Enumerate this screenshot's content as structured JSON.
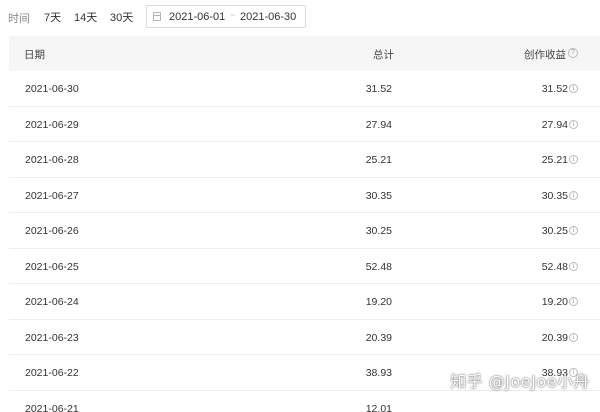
{
  "filter": {
    "label": "时间",
    "ranges": [
      "7天",
      "14天",
      "30天"
    ],
    "date_start": "2021-06-01",
    "date_separator": "~",
    "date_end": "2021-06-30"
  },
  "table": {
    "headers": {
      "date": "日期",
      "total": "总计",
      "income": "创作收益"
    },
    "rows": [
      {
        "date": "2021-06-30",
        "total": "31.52",
        "income": "31.52"
      },
      {
        "date": "2021-06-29",
        "total": "27.94",
        "income": "27.94"
      },
      {
        "date": "2021-06-28",
        "total": "25.21",
        "income": "25.21"
      },
      {
        "date": "2021-06-27",
        "total": "30.35",
        "income": "30.35"
      },
      {
        "date": "2021-06-26",
        "total": "30.25",
        "income": "30.25"
      },
      {
        "date": "2021-06-25",
        "total": "52.48",
        "income": "52.48"
      },
      {
        "date": "2021-06-24",
        "total": "19.20",
        "income": "19.20"
      },
      {
        "date": "2021-06-23",
        "total": "20.39",
        "income": "20.39"
      },
      {
        "date": "2021-06-22",
        "total": "38.93",
        "income": "38.93"
      },
      {
        "date": "2021-06-21",
        "total": "12.01",
        "income": ""
      }
    ]
  },
  "watermark": "知乎 @JoeJoe小舟"
}
